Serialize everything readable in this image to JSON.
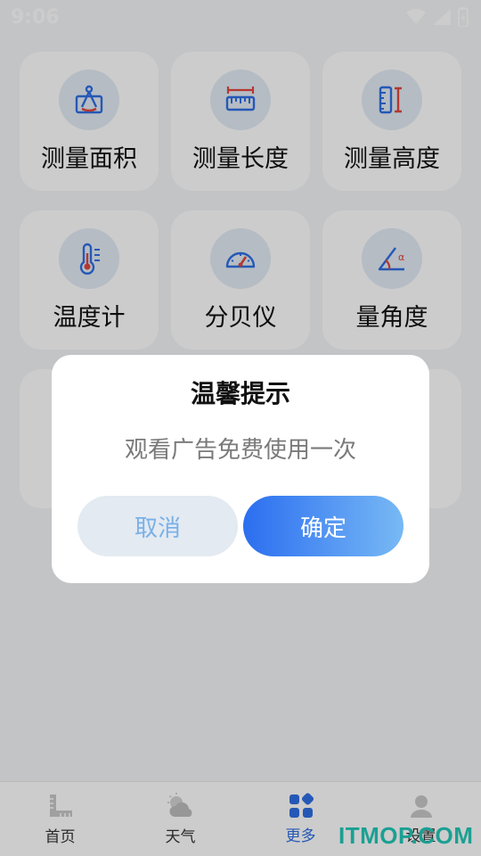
{
  "status_bar": {
    "time": "9:06",
    "icons": [
      "wifi-icon",
      "signal-icon",
      "battery-icon"
    ]
  },
  "tools": [
    {
      "label": "测量面积",
      "icon": "area-icon"
    },
    {
      "label": "测量长度",
      "icon": "ruler-icon"
    },
    {
      "label": "测量高度",
      "icon": "height-icon"
    },
    {
      "label": "温度计",
      "icon": "thermometer-icon"
    },
    {
      "label": "分贝仪",
      "icon": "decibel-meter-icon"
    },
    {
      "label": "量角度",
      "icon": "angle-icon"
    }
  ],
  "dialog": {
    "title": "温馨提示",
    "message": "观看广告免费使用一次",
    "cancel_label": "取消",
    "confirm_label": "确定"
  },
  "tabbar": [
    {
      "label": "首页",
      "icon": "ruler-corner-icon",
      "active": false
    },
    {
      "label": "天气",
      "icon": "weather-icon",
      "active": false
    },
    {
      "label": "更多",
      "icon": "more-apps-icon",
      "active": true
    },
    {
      "label": "设置",
      "icon": "profile-icon",
      "active": false
    }
  ],
  "watermark": "ITMOP.COM",
  "colors": {
    "accent": "#2f6fe4",
    "icon_blue": "#2f6fe4",
    "icon_red": "#e2463c"
  }
}
